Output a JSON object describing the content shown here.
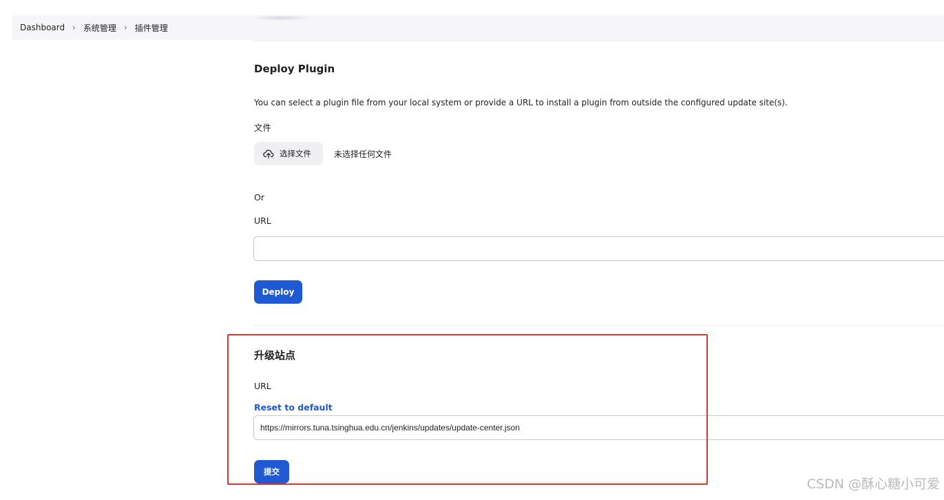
{
  "breadcrumb": {
    "items": [
      "Dashboard",
      "系统管理",
      "插件管理"
    ],
    "separator": "›"
  },
  "deploy": {
    "title": "Deploy Plugin",
    "description": "You can select a plugin file from your local system or provide a URL to install a plugin from outside the configured update site(s).",
    "file_label": "文件",
    "file_button": "选择文件",
    "file_status": "未选择任何文件",
    "or_label": "Or",
    "url_label": "URL",
    "url_value": "",
    "button": "Deploy"
  },
  "update_site": {
    "title": "升级站点",
    "url_label": "URL",
    "reset_link": "Reset to default",
    "url_value": "https://mirrors.tuna.tsinghua.edu.cn/jenkins/updates/update-center.json",
    "submit_button": "提交"
  },
  "watermark": "CSDN @酥心糖小可爱",
  "colors": {
    "accent": "#2059d4",
    "highlight": "#e0332c",
    "breadcrumb_bg": "#f6f6f8"
  }
}
